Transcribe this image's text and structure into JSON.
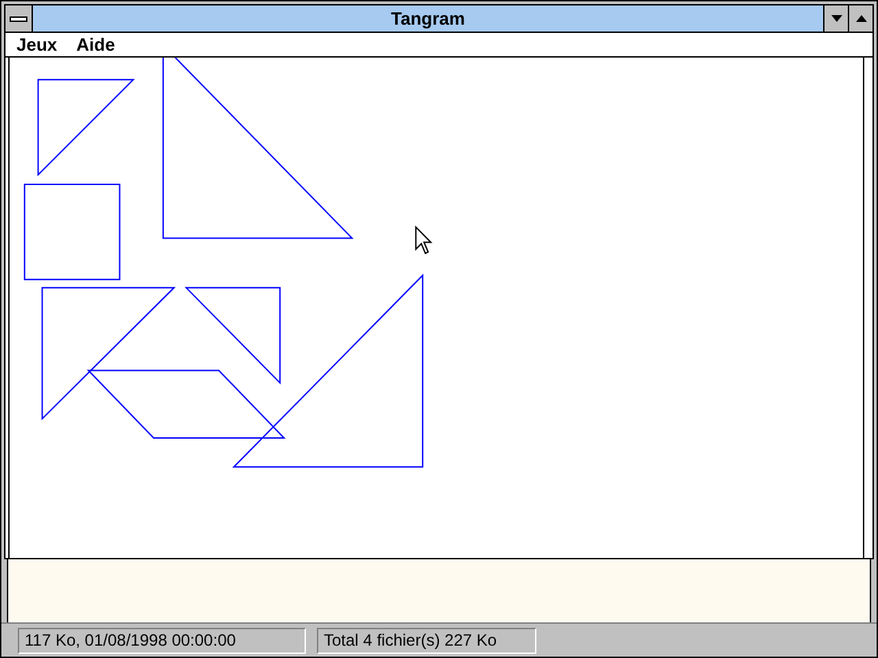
{
  "window": {
    "title": "Tangram"
  },
  "menu": [
    "Jeux",
    "Aide"
  ],
  "status_bar": [
    "117 Ko, 01/08/1998 00:00:00",
    "Total 4 fichier(s) 227 Ko"
  ]
}
